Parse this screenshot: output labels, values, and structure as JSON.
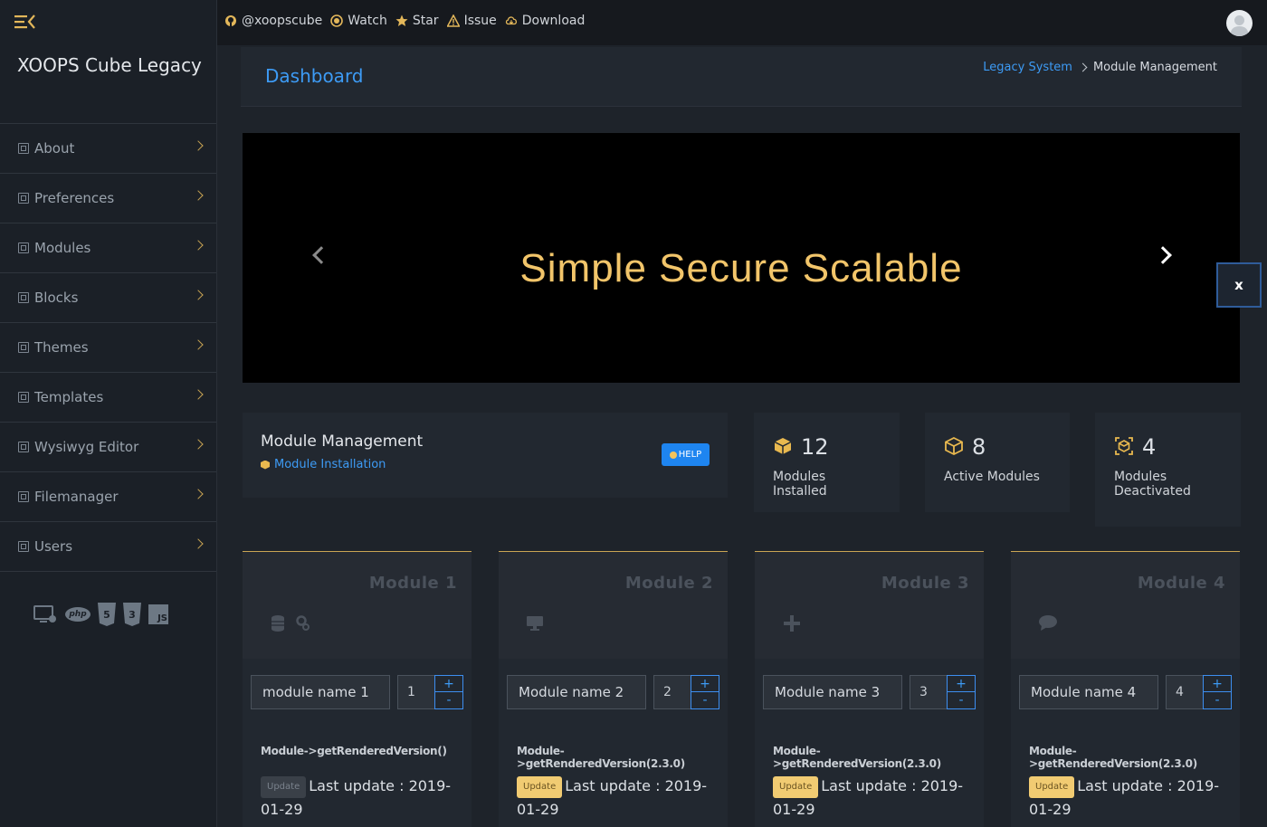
{
  "app": {
    "brand": "XOOPS Cube Legacy"
  },
  "topbar": {
    "links": [
      {
        "label": "@xoopscube",
        "icon": "github-icon"
      },
      {
        "label": "Watch",
        "icon": "eye-icon"
      },
      {
        "label": "Star",
        "icon": "star-icon"
      },
      {
        "label": "Issue",
        "icon": "warning-icon"
      },
      {
        "label": "Download",
        "icon": "cloud-download-icon"
      }
    ]
  },
  "sidebar": {
    "items": [
      {
        "label": "About"
      },
      {
        "label": "Preferences"
      },
      {
        "label": "Modules"
      },
      {
        "label": "Blocks"
      },
      {
        "label": "Themes"
      },
      {
        "label": "Templates"
      },
      {
        "label": "Wysiwyg Editor"
      },
      {
        "label": "Filemanager"
      },
      {
        "label": "Users"
      }
    ],
    "tech": [
      "php",
      "5",
      "3",
      "JS"
    ]
  },
  "header": {
    "title": "Dashboard",
    "breadcrumb_link": "Legacy System",
    "breadcrumb_current": "Module Management"
  },
  "carousel": {
    "slogan": "Simple Secure Scalable",
    "close_label": "x"
  },
  "management": {
    "title": "Module Management",
    "subtitle": "Module Installation",
    "help_label": "HELP"
  },
  "stats": [
    {
      "value": "12",
      "label": "Modules Installed",
      "icon": "cube-icon"
    },
    {
      "value": "8",
      "label": "Active Modules",
      "icon": "cube-outline-icon"
    },
    {
      "value": "4",
      "label": "Modules Deactivated",
      "icon": "cube-dashed-icon"
    }
  ],
  "modules": [
    {
      "title": "Module 1",
      "name": "module name 1",
      "weight": "1",
      "version": "Module->getRenderedVersion()",
      "badge": "Update",
      "updated": "Last update : 2019-01-29",
      "icon": "database-gear-icon"
    },
    {
      "title": "Module 2",
      "name": "Module name 2",
      "weight": "2",
      "version": "Module->getRenderedVersion(2.3.0)",
      "badge": "Update",
      "updated": "Last update : 2019-01-29",
      "icon": "monitor-icon"
    },
    {
      "title": "Module 3",
      "name": "Module name 3",
      "weight": "3",
      "version": "Module->getRenderedVersion(2.3.0)",
      "badge": "Update",
      "updated": "Last update : 2019-01-29",
      "icon": "plus-icon"
    },
    {
      "title": "Module 4",
      "name": "Module name 4",
      "weight": "4",
      "version": "Module->getRenderedVersion(2.3.0)",
      "badge": "Update",
      "updated": "Last update : 2019-01-29",
      "icon": "comment-icon"
    }
  ],
  "stepper": {
    "plus": "+",
    "minus": "-"
  },
  "colors": {
    "accent": "#3d9bf5",
    "gold": "#e9b94f",
    "background": "#1e232a",
    "sidebar": "#1b2027"
  }
}
